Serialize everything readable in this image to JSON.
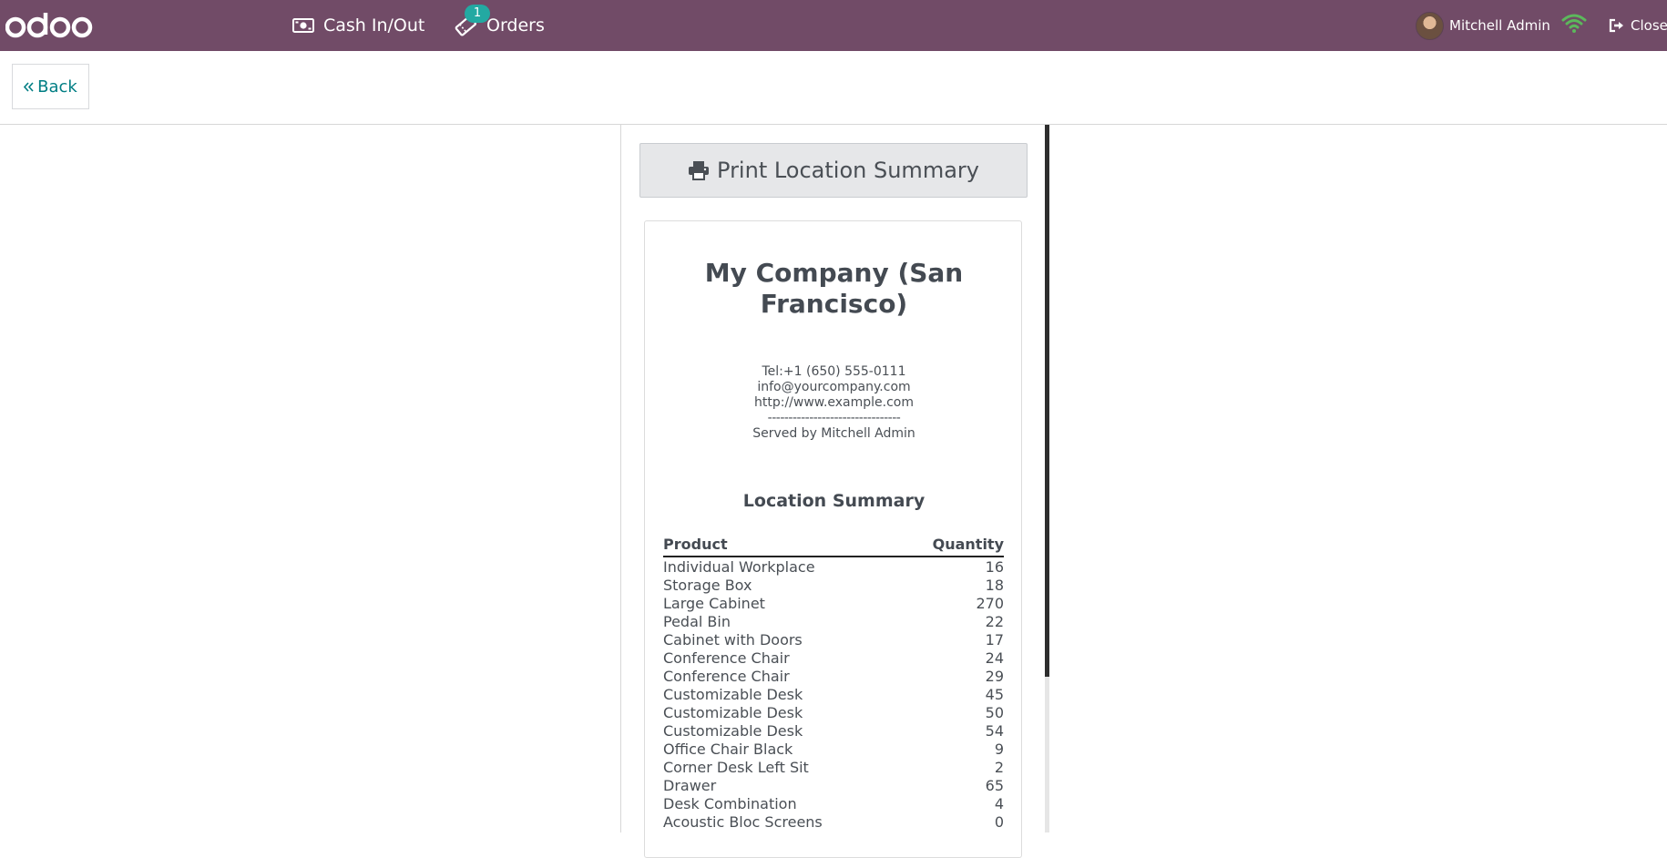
{
  "navbar": {
    "logo_text": "odoo",
    "cash_label": "Cash In/Out",
    "orders_label": "Orders",
    "orders_badge": "1",
    "user_name": "Mitchell Admin",
    "close_label": "Close",
    "colors": {
      "bar": "#714b67",
      "badge": "#23a9a2",
      "wifi": "#5cb85c"
    },
    "icons": [
      "money-icon",
      "ticket-icon",
      "wifi-icon",
      "sign-out-icon"
    ]
  },
  "subbar": {
    "back_label": "Back"
  },
  "print_button": {
    "label": "Print Location Summary",
    "icon": "printer-icon"
  },
  "receipt": {
    "company_line1": "My Company (San",
    "company_line2": "Francisco)",
    "tel": "Tel:+1 (650) 555-0111",
    "email": "info@yourcompany.com",
    "website": "http://www.example.com",
    "separator": "--------------------------------",
    "served_by": "Served by Mitchell Admin",
    "summary_title": "Location Summary",
    "columns": {
      "product": "Product",
      "quantity": "Quantity"
    },
    "rows": [
      {
        "product": "Individual Workplace",
        "qty": "16"
      },
      {
        "product": "Storage Box",
        "qty": "18"
      },
      {
        "product": "Large Cabinet",
        "qty": "270"
      },
      {
        "product": "Pedal Bin",
        "qty": "22"
      },
      {
        "product": "Cabinet with Doors",
        "qty": "17"
      },
      {
        "product": "Conference Chair",
        "qty": "24"
      },
      {
        "product": "Conference Chair",
        "qty": "29"
      },
      {
        "product": "Customizable Desk",
        "qty": "45"
      },
      {
        "product": "Customizable Desk",
        "qty": "50"
      },
      {
        "product": "Customizable Desk",
        "qty": "54"
      },
      {
        "product": "Office Chair Black",
        "qty": "9"
      },
      {
        "product": "Corner Desk Left Sit",
        "qty": "2"
      },
      {
        "product": "Drawer",
        "qty": "65"
      },
      {
        "product": "Desk Combination",
        "qty": "4"
      },
      {
        "product": "Acoustic Bloc Screens",
        "qty": "0"
      }
    ]
  }
}
